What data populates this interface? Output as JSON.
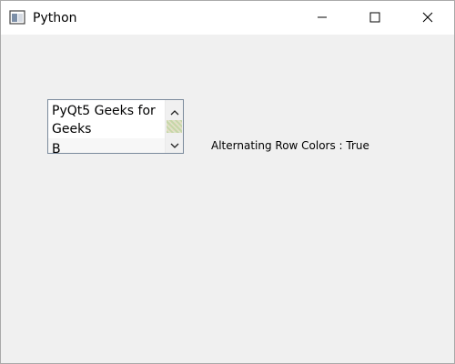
{
  "window": {
    "title": "Python",
    "icon": "python-window-icon",
    "controls": [
      "minimize-icon",
      "maximize-icon",
      "close-icon"
    ]
  },
  "list": {
    "items": [
      "PyQt5 Geeks for Geeks",
      "B"
    ]
  },
  "label": {
    "text": "Alternating Row Colors : True"
  },
  "colors": {
    "background": "#f0f0f0",
    "alternate_row": "#f7f7f7",
    "list_border": "#7a8a9c"
  }
}
